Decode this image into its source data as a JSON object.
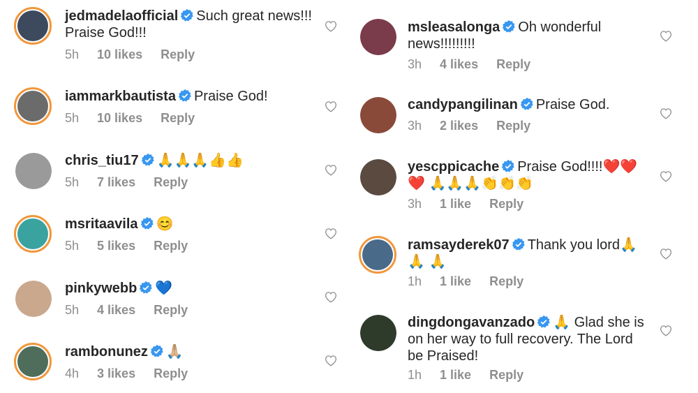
{
  "left_comments": [
    {
      "username": "jedmadelaofficial",
      "text": "Such great news!!! Praise God!!!",
      "time": "5h",
      "likes": "10 likes",
      "reply": "Reply",
      "avatar_color": "#3d4a5e",
      "ring": true
    },
    {
      "username": "iammarkbautista",
      "text": "Praise God!",
      "time": "5h",
      "likes": "10 likes",
      "reply": "Reply",
      "avatar_color": "#6b6b6b",
      "ring": true
    },
    {
      "username": "chris_tiu17",
      "text": "🙏🙏🙏👍👍",
      "time": "5h",
      "likes": "7 likes",
      "reply": "Reply",
      "avatar_color": "#9a9a9a",
      "ring": false
    },
    {
      "username": "msritaavila",
      "text": "😊",
      "time": "5h",
      "likes": "5 likes",
      "reply": "Reply",
      "avatar_color": "#3aa3a0",
      "ring": true
    },
    {
      "username": "pinkywebb",
      "text": "💙",
      "time": "5h",
      "likes": "4 likes",
      "reply": "Reply",
      "avatar_color": "#c9a88e",
      "ring": false
    },
    {
      "username": "rambonunez",
      "text": "🙏🏼",
      "time": "4h",
      "likes": "3 likes",
      "reply": "Reply",
      "avatar_color": "#4e6d5a",
      "ring": true
    }
  ],
  "right_comments": [
    {
      "username": "msleasalonga",
      "text": "Oh wonderful news!!!!!!!!!",
      "time": "3h",
      "likes": "4 likes",
      "reply": "Reply",
      "avatar_color": "#7a3b4a",
      "ring": false
    },
    {
      "username": "candypangilinan",
      "text": "Praise God.",
      "time": "3h",
      "likes": "2 likes",
      "reply": "Reply",
      "avatar_color": "#8a4a3a",
      "ring": false
    },
    {
      "username": "yescppicache",
      "text": "Praise God!!!!❤️❤️❤️ 🙏🙏🙏👏👏👏",
      "time": "3h",
      "likes": "1 like",
      "reply": "Reply",
      "avatar_color": "#5a4a40",
      "ring": false
    },
    {
      "username": "ramsayderek07",
      "text": "Thank you lord🙏🙏 🙏",
      "time": "1h",
      "likes": "1 like",
      "reply": "Reply",
      "avatar_color": "#4a6a8a",
      "ring": true
    },
    {
      "username": "dingdongavanzado",
      "text": "🙏 Glad she is on her way to full recovery. The Lord be Praised!",
      "time": "1h",
      "likes": "1 like",
      "reply": "Reply",
      "avatar_color": "#2e3b2a",
      "ring": false
    }
  ],
  "colors": {
    "verified": "#3897f0",
    "meta": "#8e8e8e",
    "ring": "#f1963b",
    "heart": "#8e8e8e"
  },
  "icons": {
    "verified": "verified-badge-icon",
    "heart": "heart-outline-icon"
  }
}
